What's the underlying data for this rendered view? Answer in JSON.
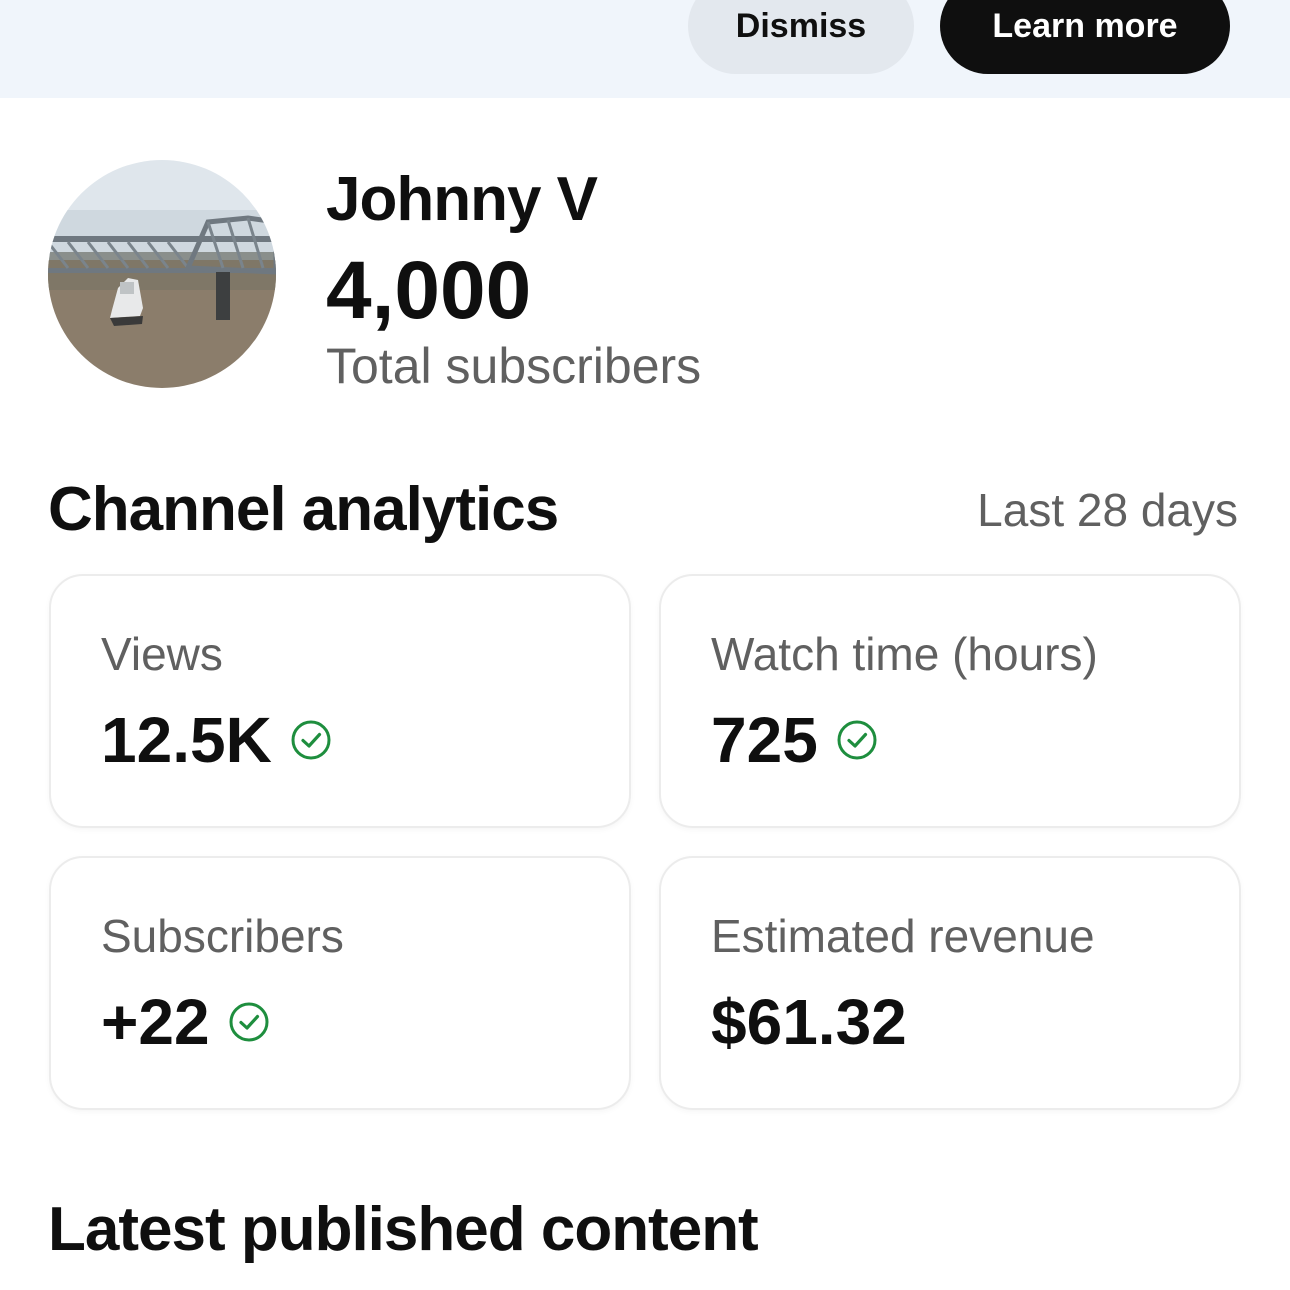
{
  "banner": {
    "dismiss_label": "Dismiss",
    "learn_more_label": "Learn more"
  },
  "channel": {
    "name": "Johnny V",
    "subscriber_count": "4,000",
    "subscriber_label": "Total subscribers",
    "avatar_icon": "bridge-river-photo"
  },
  "analytics": {
    "title": "Channel analytics",
    "range": "Last 28 days",
    "cards": [
      {
        "label": "Views",
        "value": "12.5K",
        "verified": true
      },
      {
        "label": "Watch time (hours)",
        "value": "725",
        "verified": true
      },
      {
        "label": "Subscribers",
        "value": "+22",
        "verified": true
      },
      {
        "label": "Estimated revenue",
        "value": "$61.32",
        "verified": false
      }
    ]
  },
  "latest": {
    "title": "Latest published content"
  },
  "colors": {
    "banner_bg": "#f0f5fb",
    "check_green": "#1e8e3e",
    "secondary_text": "#606060"
  }
}
